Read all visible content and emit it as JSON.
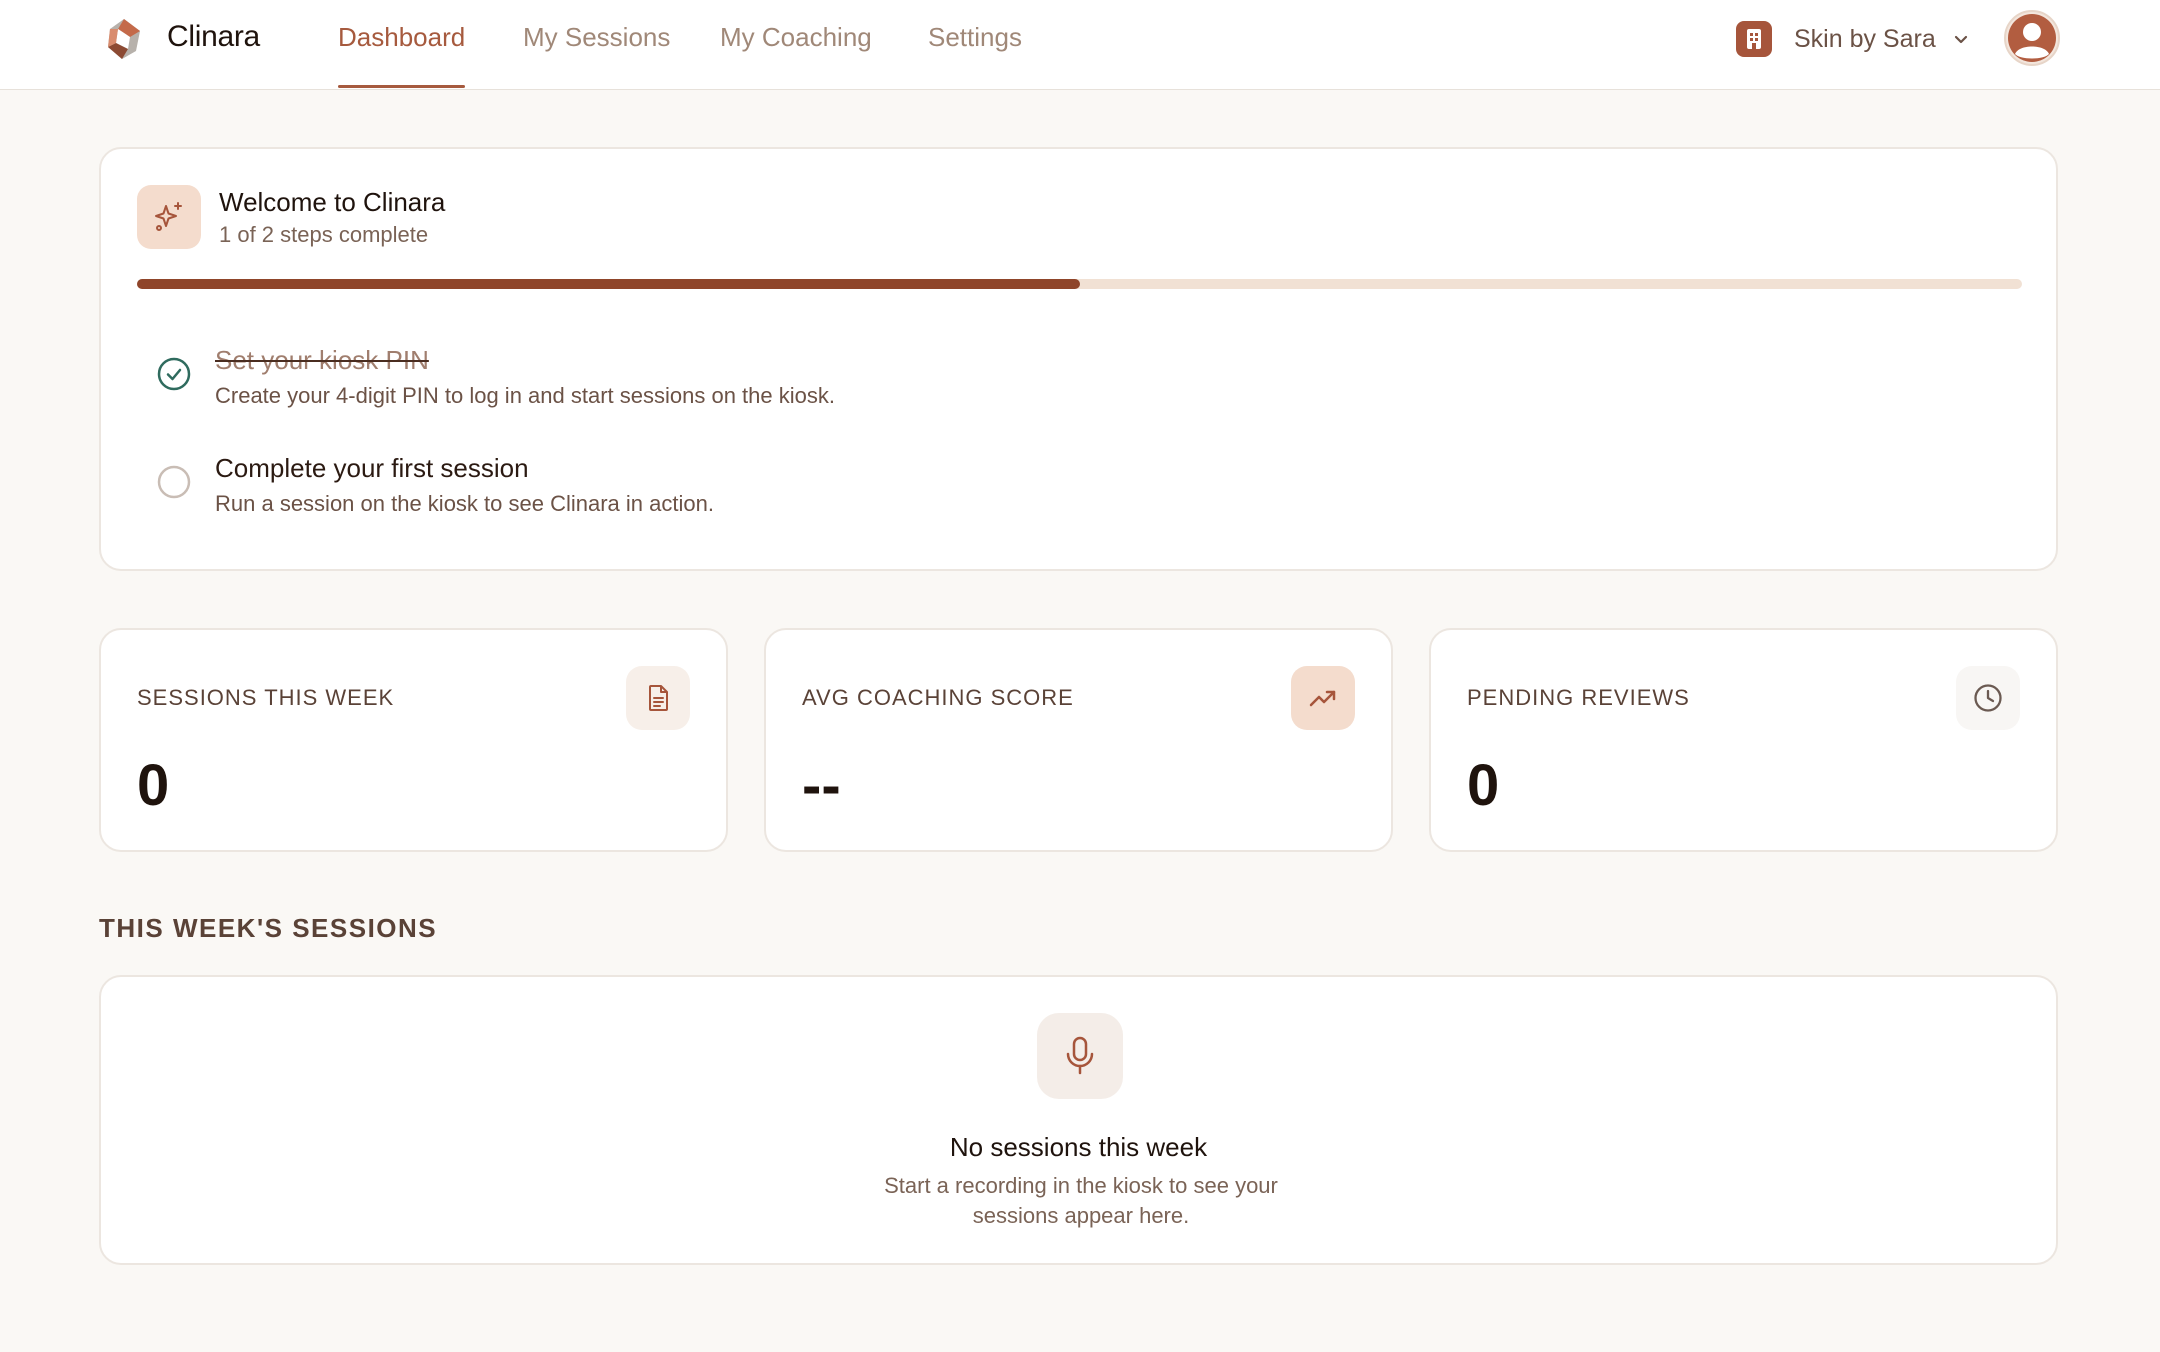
{
  "brand": {
    "name": "Clinara"
  },
  "nav": {
    "tabs": [
      {
        "label": "Dashboard",
        "active": true
      },
      {
        "label": "My Sessions",
        "active": false
      },
      {
        "label": "My Coaching",
        "active": false
      },
      {
        "label": "Settings",
        "active": false
      }
    ]
  },
  "org": {
    "name": "Skin by Sara",
    "icon": "building-icon"
  },
  "user": {
    "avatar_icon": "user-icon"
  },
  "onboarding": {
    "title": "Welcome to Clinara",
    "subtitle": "1 of 2 steps complete",
    "progress": 0.5,
    "steps": [
      {
        "title": "Set your kiosk PIN",
        "description": "Create your 4-digit PIN to log in and start sessions on the kiosk.",
        "done": true
      },
      {
        "title": "Complete your first session",
        "description": "Run a session on the kiosk to see Clinara in action.",
        "done": false
      }
    ]
  },
  "stats": [
    {
      "label": "SESSIONS THIS WEEK",
      "value": "0",
      "icon": "document-icon"
    },
    {
      "label": "AVG COACHING SCORE",
      "value": "--",
      "icon": "trending-up-icon"
    },
    {
      "label": "PENDING REVIEWS",
      "value": "0",
      "icon": "clock-icon"
    }
  ],
  "sessions_section": {
    "title": "THIS WEEK'S SESSIONS",
    "empty_title": "No sessions this week",
    "empty_description": "Start a recording in the kiosk to see your sessions appear here.",
    "icon": "microphone-icon"
  },
  "colors": {
    "accent": "#a65a3e",
    "progress_fill": "#8f452a",
    "progress_track": "#f1e1d4",
    "check_green": "#2f6b5e",
    "background": "#faf8f5"
  }
}
